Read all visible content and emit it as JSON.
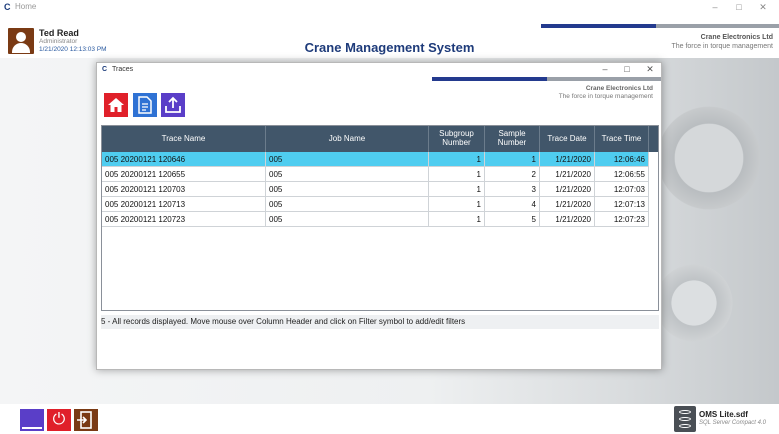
{
  "main": {
    "window_title": "Home",
    "app_icon": "crane-c-icon",
    "controls": {
      "minimize": "–",
      "maximize": "□",
      "close": "✕"
    },
    "user": {
      "name": "Ted Read",
      "role": "Administrator",
      "datetime": "1/21/2020 12:13:03 PM"
    },
    "app_title": "Crane Management System",
    "brand": {
      "name": "Crane Electronics Ltd",
      "tagline": "The force in torque management"
    },
    "database": {
      "name": "OMS Lite.sdf",
      "type": "SQL Server Compact 4.0"
    },
    "bottom_buttons": [
      {
        "icon": "minimize-window-icon",
        "color": "#5a3ec8"
      },
      {
        "icon": "power-icon",
        "color": "#e0202a",
        "glyph": "⏻"
      },
      {
        "icon": "exit-door-icon",
        "color": "#7a3a14"
      }
    ],
    "colors": {
      "accent_blue": "#233a8e",
      "title_blue": "#1e3b7a",
      "accent_brown": "#7a3a14"
    }
  },
  "dialog": {
    "title": "Traces",
    "controls": {
      "minimize": "–",
      "maximize": "□",
      "close": "✕"
    },
    "brand": {
      "name": "Crane Electronics Ltd",
      "tagline": "The force in torque management"
    },
    "toolbar": [
      {
        "name": "home",
        "icon": "home-icon",
        "color": "#e0202a"
      },
      {
        "name": "report",
        "icon": "report-icon",
        "color": "#2f72d4"
      },
      {
        "name": "export",
        "icon": "export-icon",
        "color": "#5a3ec8"
      }
    ],
    "grid": {
      "columns": [
        "Trace Name",
        "Job Name",
        "Subgroup Number",
        "Sample Number",
        "Trace Date",
        "Trace Time"
      ],
      "rows": [
        [
          "005 20200121 120646",
          "005",
          "1",
          "1",
          "1/21/2020",
          "12:06:46"
        ],
        [
          "005 20200121 120655",
          "005",
          "1",
          "2",
          "1/21/2020",
          "12:06:55"
        ],
        [
          "005 20200121 120703",
          "005",
          "1",
          "3",
          "1/21/2020",
          "12:07:03"
        ],
        [
          "005 20200121 120713",
          "005",
          "1",
          "4",
          "1/21/2020",
          "12:07:13"
        ],
        [
          "005 20200121 120723",
          "005",
          "1",
          "5",
          "1/21/2020",
          "12:07:23"
        ]
      ],
      "selected_row": 0,
      "header_color": "#41566a",
      "selected_color": "#4fcdf0"
    },
    "status": "5 - All records displayed. Move mouse over Column Header and click on Filter symbol to add/edit filters"
  }
}
